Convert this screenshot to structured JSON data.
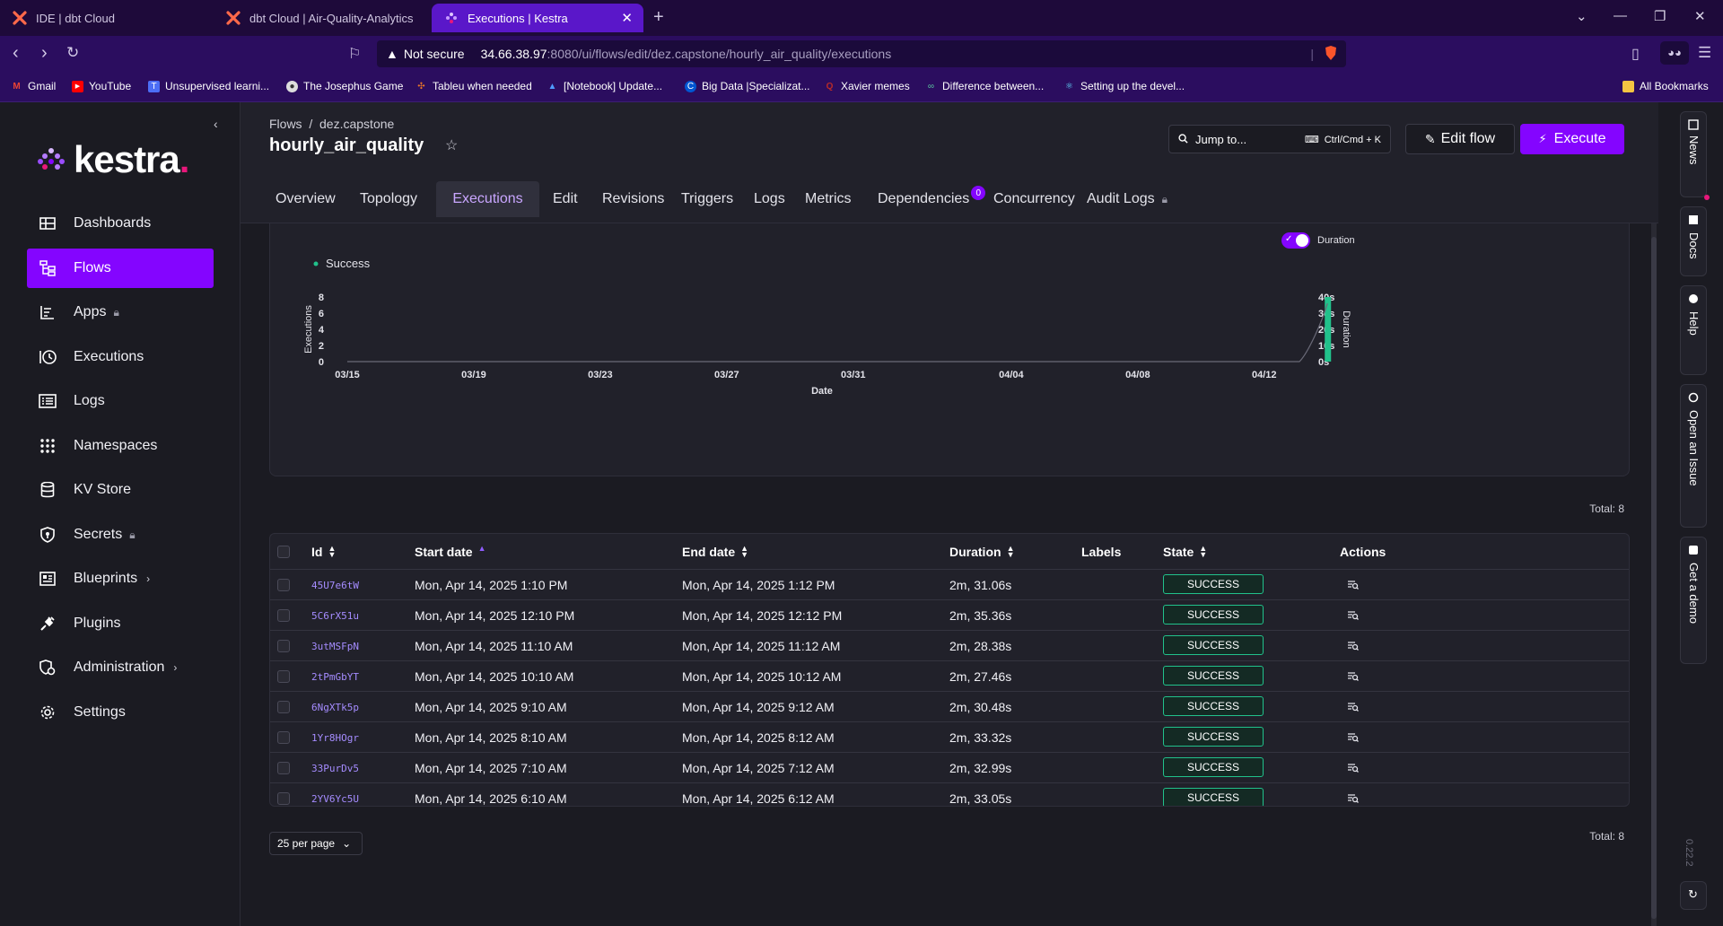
{
  "browser": {
    "tabs": [
      {
        "label": "IDE | dbt Cloud"
      },
      {
        "label": "dbt Cloud | Air-Quality-Analytics"
      },
      {
        "label": "Executions | Kestra"
      }
    ],
    "security_label": "Not secure",
    "url_host": "34.66.38.97",
    "url_path": ":8080/ui/flows/edit/dez.capstone/hourly_air_quality/executions",
    "bookmarks": [
      {
        "label": "Gmail",
        "icon": "gmail-icon"
      },
      {
        "label": "YouTube",
        "icon": "youtube-icon"
      },
      {
        "label": "Unsupervised learni...",
        "icon": "bookmark-icon"
      },
      {
        "label": "The Josephus Game",
        "icon": "globe-icon"
      },
      {
        "label": "Tableu when needed",
        "icon": "tableau-icon"
      },
      {
        "label": "[Notebook] Update...",
        "icon": "notebook-icon"
      },
      {
        "label": "Big Data |Specializat...",
        "icon": "coursera-icon"
      },
      {
        "label": "Xavier memes",
        "icon": "quora-icon"
      },
      {
        "label": "Difference between...",
        "icon": "link-icon"
      },
      {
        "label": "Setting up the devel...",
        "icon": "react-icon"
      },
      {
        "label": "All Bookmarks",
        "icon": "folder-icon"
      }
    ]
  },
  "sidebar": {
    "logo_text": "kestra",
    "items": [
      {
        "label": "Dashboards",
        "icon": "dashboard-icon"
      },
      {
        "label": "Flows",
        "icon": "flows-icon",
        "active": true
      },
      {
        "label": "Apps",
        "icon": "apps-icon",
        "locked": true
      },
      {
        "label": "Executions",
        "icon": "history-icon"
      },
      {
        "label": "Logs",
        "icon": "logs-icon"
      },
      {
        "label": "Namespaces",
        "icon": "grid-icon"
      },
      {
        "label": "KV Store",
        "icon": "database-icon"
      },
      {
        "label": "Secrets",
        "icon": "shield-icon",
        "locked": true
      },
      {
        "label": "Blueprints",
        "icon": "blueprint-icon",
        "chevron": true
      },
      {
        "label": "Plugins",
        "icon": "plug-icon"
      },
      {
        "label": "Administration",
        "icon": "admin-icon",
        "chevron": true
      },
      {
        "label": "Settings",
        "icon": "gear-icon"
      }
    ]
  },
  "header": {
    "breadcrumb_root": "Flows",
    "breadcrumb_sep": "/",
    "breadcrumb_namespace": "dez.capstone",
    "title": "hourly_air_quality",
    "jump_label": "Jump to...",
    "jump_shortcut": "Ctrl/Cmd + K",
    "edit_label": "Edit flow",
    "execute_label": "Execute",
    "tabs": [
      {
        "label": "Overview"
      },
      {
        "label": "Topology"
      },
      {
        "label": "Executions",
        "active": true
      },
      {
        "label": "Edit"
      },
      {
        "label": "Revisions"
      },
      {
        "label": "Triggers"
      },
      {
        "label": "Logs"
      },
      {
        "label": "Metrics"
      },
      {
        "label": "Dependencies",
        "badge": "0"
      },
      {
        "label": "Concurrency"
      },
      {
        "label": "Audit Logs",
        "locked": true
      }
    ]
  },
  "chart_data": {
    "type": "bar",
    "legend": [
      {
        "name": "Success",
        "color": "#21c18b"
      }
    ],
    "duration_toggle_label": "Duration",
    "duration_toggle_on": true,
    "xlabel": "Date",
    "ylabel": "Executions",
    "y2label": "Duration",
    "x_ticks": [
      "03/15",
      "03/19",
      "03/23",
      "03/27",
      "03/31",
      "04/04",
      "04/08",
      "04/12"
    ],
    "y_ticks": [
      "0",
      "2",
      "4",
      "6",
      "8"
    ],
    "y2_ticks": [
      "0s",
      "10s",
      "20s",
      "30s",
      "40s"
    ],
    "ylim": [
      0,
      8
    ],
    "y2lim": [
      0,
      40
    ],
    "series": [
      {
        "name": "Success",
        "x": [
          "04/14"
        ],
        "values": [
          8
        ]
      }
    ],
    "duration_line": {
      "x": [
        "04/13",
        "04/14"
      ],
      "values": [
        0,
        36
      ]
    }
  },
  "table": {
    "total_label": "Total: 8",
    "columns": [
      "Id",
      "Start date",
      "End date",
      "Duration",
      "Labels",
      "State",
      "Actions"
    ],
    "rows": [
      {
        "id": "45U7e6tW",
        "start": "Mon, Apr 14, 2025 1:10 PM",
        "end": "Mon, Apr 14, 2025 1:12 PM",
        "duration": "2m, 31.06s",
        "state": "SUCCESS"
      },
      {
        "id": "5C6rX51u",
        "start": "Mon, Apr 14, 2025 12:10 PM",
        "end": "Mon, Apr 14, 2025 12:12 PM",
        "duration": "2m, 35.36s",
        "state": "SUCCESS"
      },
      {
        "id": "3utMSFpN",
        "start": "Mon, Apr 14, 2025 11:10 AM",
        "end": "Mon, Apr 14, 2025 11:12 AM",
        "duration": "2m, 28.38s",
        "state": "SUCCESS"
      },
      {
        "id": "2tPmGbYT",
        "start": "Mon, Apr 14, 2025 10:10 AM",
        "end": "Mon, Apr 14, 2025 10:12 AM",
        "duration": "2m, 27.46s",
        "state": "SUCCESS"
      },
      {
        "id": "6NgXTk5p",
        "start": "Mon, Apr 14, 2025 9:10 AM",
        "end": "Mon, Apr 14, 2025 9:12 AM",
        "duration": "2m, 30.48s",
        "state": "SUCCESS"
      },
      {
        "id": "1Yr8HOgr",
        "start": "Mon, Apr 14, 2025 8:10 AM",
        "end": "Mon, Apr 14, 2025 8:12 AM",
        "duration": "2m, 33.32s",
        "state": "SUCCESS"
      },
      {
        "id": "33PurDv5",
        "start": "Mon, Apr 14, 2025 7:10 AM",
        "end": "Mon, Apr 14, 2025 7:12 AM",
        "duration": "2m, 32.99s",
        "state": "SUCCESS"
      },
      {
        "id": "2YV6Yc5U",
        "start": "Mon, Apr 14, 2025 6:10 AM",
        "end": "Mon, Apr 14, 2025 6:12 AM",
        "duration": "2m, 33.05s",
        "state": "SUCCESS"
      }
    ],
    "per_page_label": "25 per page",
    "total_bottom_label": "Total: 8"
  },
  "right_rail": {
    "items": [
      {
        "label": "News",
        "icon": "news-icon"
      },
      {
        "label": "Docs",
        "icon": "docs-icon"
      },
      {
        "label": "Help",
        "icon": "help-icon"
      },
      {
        "label": "Open an Issue",
        "icon": "github-icon"
      },
      {
        "label": "Get a demo",
        "icon": "demo-icon"
      }
    ],
    "version": "0.22.2"
  },
  "colors": {
    "accent": "#8405ff",
    "success": "#21c18b",
    "browser_tab_active": "#5a17c9",
    "browser_bar": "#2b0d5f"
  }
}
